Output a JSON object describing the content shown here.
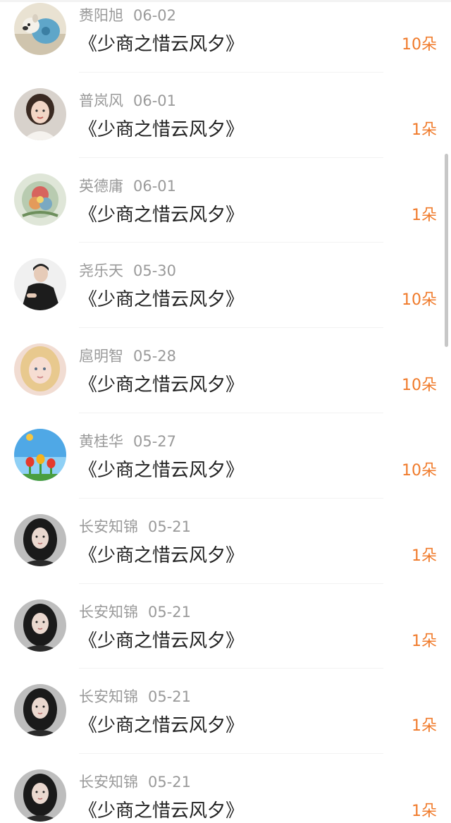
{
  "entries": [
    {
      "name": "赉阳旭",
      "date": "06-02",
      "title": "《少商之惜云风夕》",
      "gift": "10朵",
      "avatar_icon": "dog-avatar-icon"
    },
    {
      "name": "普岚风",
      "date": "06-01",
      "title": "《少商之惜云风夕》",
      "gift": "1朵",
      "avatar_icon": "woman-avatar-icon"
    },
    {
      "name": "英德庸",
      "date": "06-01",
      "title": "《少商之惜云风夕》",
      "gift": "1朵",
      "avatar_icon": "flower-art-avatar-icon"
    },
    {
      "name": "尧乐天",
      "date": "05-30",
      "title": "《少商之惜云风夕》",
      "gift": "10朵",
      "avatar_icon": "man-avatar-icon"
    },
    {
      "name": "扈明智",
      "date": "05-28",
      "title": "《少商之惜云风夕》",
      "gift": "10朵",
      "avatar_icon": "blonde-child-avatar-icon"
    },
    {
      "name": "黄桂华",
      "date": "05-27",
      "title": "《少商之惜云风夕》",
      "gift": "10朵",
      "avatar_icon": "tulips-avatar-icon"
    },
    {
      "name": "长安知锦",
      "date": "05-21",
      "title": "《少商之惜云风夕》",
      "gift": "1朵",
      "avatar_icon": "girl-avatar-icon"
    },
    {
      "name": "长安知锦",
      "date": "05-21",
      "title": "《少商之惜云风夕》",
      "gift": "1朵",
      "avatar_icon": "girl-avatar-icon"
    },
    {
      "name": "长安知锦",
      "date": "05-21",
      "title": "《少商之惜云风夕》",
      "gift": "1朵",
      "avatar_icon": "girl-avatar-icon"
    },
    {
      "name": "长安知锦",
      "date": "05-21",
      "title": "《少商之惜云风夕》",
      "gift": "1朵",
      "avatar_icon": "girl-avatar-icon"
    }
  ],
  "colors": {
    "gift_orange": "#f07a2a",
    "meta_gray": "#9a9a9a",
    "title_text": "#222222"
  }
}
